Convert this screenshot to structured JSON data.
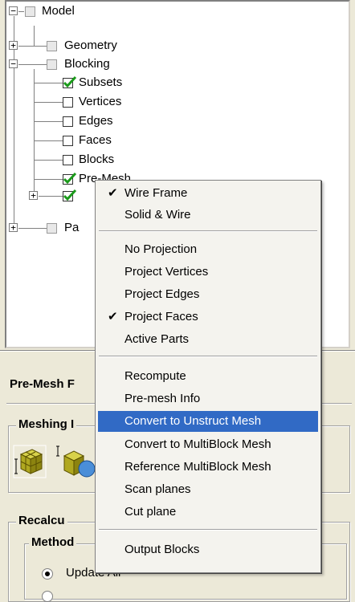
{
  "tree": {
    "nodes": [
      {
        "label": "Model",
        "checked": "grey"
      },
      {
        "label": "Geometry",
        "checked": "grey"
      },
      {
        "label": "Blocking",
        "checked": "grey"
      },
      {
        "label": "Subsets",
        "checked": "green"
      },
      {
        "label": "Vertices",
        "checked": "none"
      },
      {
        "label": "Edges",
        "checked": "none"
      },
      {
        "label": "Faces",
        "checked": "none"
      },
      {
        "label": "Blocks",
        "checked": "none"
      },
      {
        "label": "Pre-Mesh",
        "checked": "green"
      },
      {
        "label": "",
        "checked": "green"
      },
      {
        "label": "Pa",
        "checked": "grey"
      }
    ],
    "expander_collapsed": "+",
    "expander_expanded": "−"
  },
  "panel": {
    "title": "Pre-Mesh F",
    "meshing_group_label": "Meshing I",
    "recalc_group_label": "Recalcu",
    "method_group_label": "Method",
    "radio_update_all": "Update All",
    "radio_next": "..."
  },
  "context_menu": {
    "items": [
      {
        "label": "Wire Frame",
        "checked": true
      },
      {
        "label": "Solid & Wire",
        "checked": false
      },
      {
        "label": "No Projection",
        "checked": false
      },
      {
        "label": "Project Vertices",
        "checked": false
      },
      {
        "label": "Project Edges",
        "checked": false
      },
      {
        "label": "Project Faces",
        "checked": true
      },
      {
        "label": "Active Parts",
        "checked": false
      },
      {
        "label": "Recompute",
        "checked": false
      },
      {
        "label": "Pre-mesh Info",
        "checked": false
      },
      {
        "label": "Convert to Unstruct Mesh",
        "checked": false,
        "highlighted": true
      },
      {
        "label": "Convert to MultiBlock Mesh",
        "checked": false
      },
      {
        "label": "Reference MultiBlock Mesh",
        "checked": false
      },
      {
        "label": "Scan planes",
        "checked": false
      },
      {
        "label": "Cut plane",
        "checked": false
      },
      {
        "label": "Output Blocks",
        "checked": false
      }
    ],
    "check_glyph": "✔"
  },
  "colors": {
    "highlight": "#316ac5",
    "check_green": "#1a9a1a",
    "window_bg": "#ece9d8"
  }
}
